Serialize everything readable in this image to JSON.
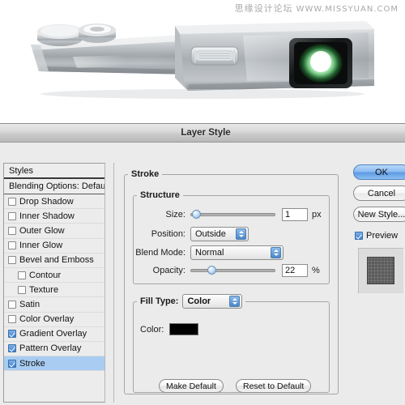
{
  "watermark": {
    "cn": "思缘设计论坛",
    "url": "WWW.MISSYUAN.COM"
  },
  "dialog": {
    "title": "Layer Style"
  },
  "styles_panel": {
    "header": "Styles",
    "blending_options": "Blending Options: Default",
    "effects": [
      {
        "label": "Drop Shadow",
        "checked": false,
        "indent": false,
        "selected": false
      },
      {
        "label": "Inner Shadow",
        "checked": false,
        "indent": false,
        "selected": false
      },
      {
        "label": "Outer Glow",
        "checked": false,
        "indent": false,
        "selected": false
      },
      {
        "label": "Inner Glow",
        "checked": false,
        "indent": false,
        "selected": false
      },
      {
        "label": "Bevel and Emboss",
        "checked": false,
        "indent": false,
        "selected": false
      },
      {
        "label": "Contour",
        "checked": false,
        "indent": true,
        "selected": false
      },
      {
        "label": "Texture",
        "checked": false,
        "indent": true,
        "selected": false
      },
      {
        "label": "Satin",
        "checked": false,
        "indent": false,
        "selected": false
      },
      {
        "label": "Color Overlay",
        "checked": false,
        "indent": false,
        "selected": false
      },
      {
        "label": "Gradient Overlay",
        "checked": true,
        "indent": false,
        "selected": false
      },
      {
        "label": "Pattern Overlay",
        "checked": true,
        "indent": false,
        "selected": false
      },
      {
        "label": "Stroke",
        "checked": true,
        "indent": false,
        "selected": true
      }
    ]
  },
  "stroke_panel": {
    "group_title": "Stroke",
    "structure_title": "Structure",
    "size_label": "Size:",
    "size_value": "1",
    "size_unit": "px",
    "size_percent": 2,
    "position_label": "Position:",
    "position_value": "Outside",
    "blend_mode_label": "Blend Mode:",
    "blend_mode_value": "Normal",
    "opacity_label": "Opacity:",
    "opacity_value": "22",
    "opacity_unit": "%",
    "opacity_percent": 22,
    "fill_type_label": "Fill Type:",
    "fill_type_value": "Color",
    "color_label": "Color:",
    "color_value": "#000000",
    "make_default": "Make Default",
    "reset_to_default": "Reset to Default"
  },
  "actions": {
    "ok": "OK",
    "cancel": "Cancel",
    "new_style": "New Style...",
    "preview": "Preview",
    "preview_checked": true
  }
}
